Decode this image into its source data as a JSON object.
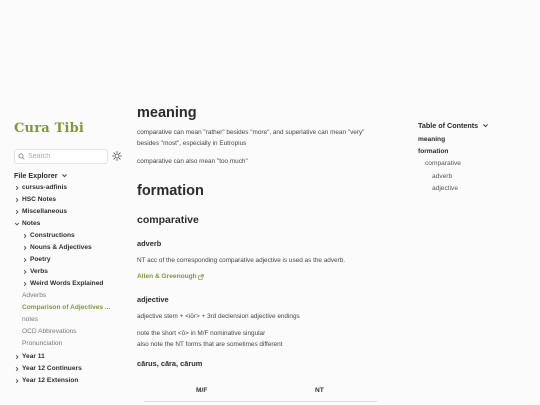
{
  "sidebar": {
    "site_title": "Cura Tibi",
    "search": {
      "placeholder": "Search",
      "value": ""
    },
    "explorer_label": "File Explorer",
    "tree": [
      {
        "label": "cursus-adfinis",
        "kind": "folder",
        "expanded": false
      },
      {
        "label": "HSC Notes",
        "kind": "folder",
        "expanded": false
      },
      {
        "label": "Miscellaneous",
        "kind": "folder",
        "expanded": false
      },
      {
        "label": "Notes",
        "kind": "folder",
        "expanded": true
      },
      {
        "label": "Constructions",
        "kind": "folder",
        "expanded": false
      },
      {
        "label": "Nouns & Adjectives",
        "kind": "folder",
        "expanded": false
      },
      {
        "label": "Poetry",
        "kind": "folder",
        "expanded": false
      },
      {
        "label": "Verbs",
        "kind": "folder",
        "expanded": false
      },
      {
        "label": "Weird Words Explained",
        "kind": "folder",
        "expanded": false
      },
      {
        "label": "Adverbs",
        "kind": "file"
      },
      {
        "label": "Comparison of Adjectives ...",
        "kind": "file",
        "active": true
      },
      {
        "label": "notes",
        "kind": "file"
      },
      {
        "label": "OCD Abbrevations",
        "kind": "file"
      },
      {
        "label": "Pronunciation",
        "kind": "file"
      },
      {
        "label": "Year 11",
        "kind": "folder",
        "expanded": false
      },
      {
        "label": "Year 12 Continuers",
        "kind": "folder",
        "expanded": false
      },
      {
        "label": "Year 12 Extension",
        "kind": "folder",
        "expanded": false
      }
    ]
  },
  "article": {
    "meaning_heading": "meaning",
    "meaning_p1_line1": "comparative can mean \"rather\" besides \"more\", and superlative can mean \"very\"",
    "meaning_p1_line2": "besides \"most\", especially in Eutropius",
    "meaning_p2": "comparative can also mean \"too much\"",
    "formation_heading": "formation",
    "comparative_heading": "comparative",
    "adverb_heading": "adverb",
    "adverb_p": "NT acc of the corresponding comparative adjective is used as the adverb.",
    "adverb_link": "Allen & Greenough",
    "adjective_heading": "adjective",
    "adjective_p": "adjective stem + <iōr> + 3rd declension adjective endings",
    "note_line1": "note the short <ŏ> in M/F nominative singular",
    "note_line2": "also note the NT forms that are sometimes different",
    "example_heading": "cārus, cāra, cārum",
    "table_headers": [
      "M/F",
      "NT"
    ]
  },
  "toc": {
    "title": "Table of Contents",
    "items": [
      {
        "label": "meaning",
        "level": 1
      },
      {
        "label": "formation",
        "level": 1
      },
      {
        "label": "comparative",
        "level": 2
      },
      {
        "label": "adverb",
        "level": 3
      },
      {
        "label": "adjective",
        "level": 3
      }
    ]
  },
  "colors": {
    "accent": "#7a9a3a",
    "background": "#fbfbfb",
    "text": "#2b2b2b"
  },
  "icons": [
    "search-icon",
    "sun-icon",
    "chevron-down-icon",
    "chevron-right-icon",
    "external-link-icon"
  ]
}
